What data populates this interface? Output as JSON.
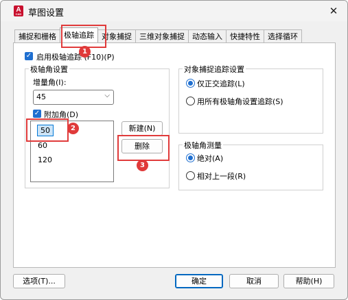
{
  "window": {
    "title": "草图设置",
    "icon_text": "A",
    "icon_subtext": "CAD",
    "close_glyph": "✕"
  },
  "tabs": [
    {
      "label": "捕捉和栅格"
    },
    {
      "label": "极轴追踪",
      "active": true
    },
    {
      "label": "对象捕捉"
    },
    {
      "label": "三维对象捕捉"
    },
    {
      "label": "动态输入"
    },
    {
      "label": "快捷特性"
    },
    {
      "label": "选择循环"
    }
  ],
  "polar": {
    "enable_label": "启用极轴追踪 (F10)(P)",
    "enable_checked": true,
    "settings_group_title": "极轴角设置",
    "increment_label": "增量角(I):",
    "increment_value": "45",
    "additional_label": "附加角(D)",
    "additional_checked": true,
    "additional_angles": [
      "50",
      "60",
      "120"
    ],
    "new_button": "新建(N)",
    "delete_button": "删除"
  },
  "osnap_tracking": {
    "group_title": "对象捕捉追踪设置",
    "option_orthogonal": "仅正交追踪(L)",
    "option_all": "用所有极轴角设置追踪(S)",
    "selected": "orthogonal"
  },
  "measurement": {
    "group_title": "极轴角测量",
    "option_absolute": "绝对(A)",
    "option_relative": "相对上一段(R)",
    "selected": "absolute"
  },
  "footer": {
    "options_button": "选项(T)...",
    "ok_button": "确定",
    "cancel_button": "取消",
    "help_button": "帮助(H)"
  },
  "annotations": {
    "color": "#e03a3a",
    "marker_1": "1",
    "marker_2": "2",
    "marker_3": "3"
  },
  "colors": {
    "accent": "#1f6fd0",
    "selection_border": "#0078d7"
  }
}
